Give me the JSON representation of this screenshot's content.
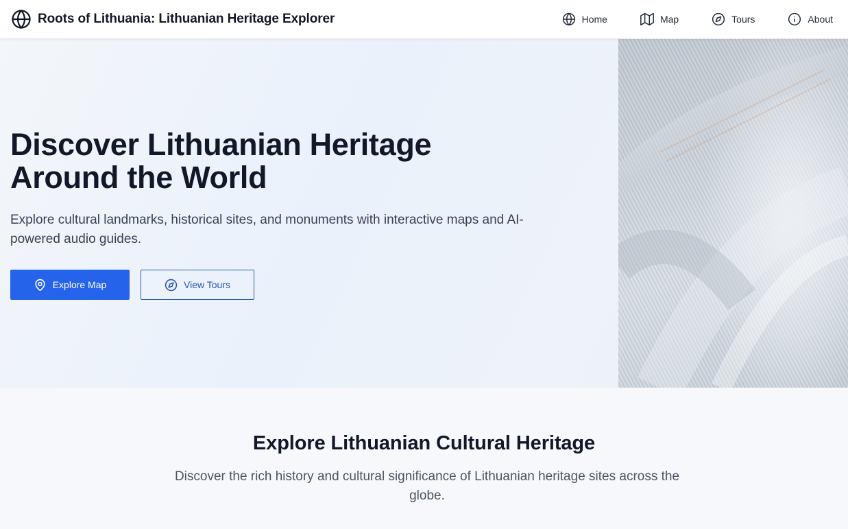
{
  "header": {
    "title": "Roots of Lithuania: Lithuanian Heritage Explorer",
    "logo_icon": "globe-icon",
    "nav": [
      {
        "label": "Home",
        "icon": "globe-icon"
      },
      {
        "label": "Map",
        "icon": "map-icon"
      },
      {
        "label": "Tours",
        "icon": "compass-icon"
      },
      {
        "label": "About",
        "icon": "info-icon"
      }
    ]
  },
  "hero": {
    "title": "Discover Lithuanian Heritage Around the World",
    "subtitle": "Explore cultural landmarks, historical sites, and monuments with interactive maps and AI-powered audio guides.",
    "primary_button": {
      "label": "Explore Map",
      "icon": "map-pin-icon"
    },
    "secondary_button": {
      "label": "View Tours",
      "icon": "compass-icon"
    },
    "image": "woven-textile-image"
  },
  "section": {
    "title": "Explore Lithuanian Cultural Heritage",
    "description": "Discover the rich history and cultural significance of Lithuanian heritage sites across the globe."
  },
  "colors": {
    "accent": "#2563eb",
    "text_primary": "#111827",
    "text_secondary": "#4b5563",
    "header_bg": "#ffffff",
    "section_bg": "#f6f8fc"
  }
}
